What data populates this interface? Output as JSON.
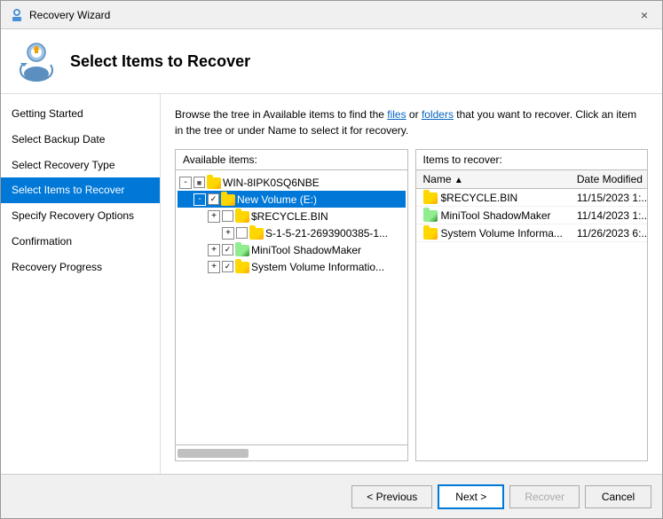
{
  "window": {
    "title": "Recovery Wizard",
    "close_label": "×"
  },
  "header": {
    "title": "Select Items to Recover"
  },
  "instruction": {
    "text1": "Browse the tree in Available items to find the files or folders that you want to recover. Click an item",
    "text2": "in the tree or under Name to select it for recovery."
  },
  "sidebar": {
    "items": [
      {
        "label": "Getting Started",
        "active": false
      },
      {
        "label": "Select Backup Date",
        "active": false
      },
      {
        "label": "Select Recovery Type",
        "active": false
      },
      {
        "label": "Select Items to Recover",
        "active": true
      },
      {
        "label": "Specify Recovery Options",
        "active": false
      },
      {
        "label": "Confirmation",
        "active": false
      },
      {
        "label": "Recovery Progress",
        "active": false
      }
    ]
  },
  "available_panel": {
    "header": "Available items:",
    "tree": [
      {
        "id": "root",
        "label": "WIN-8IPK0SQ6NBE",
        "level": 0,
        "toggle": "-",
        "folder": "yellow",
        "checked": "partial"
      },
      {
        "id": "vol_e",
        "label": "New Volume (E:)",
        "level": 1,
        "toggle": "-",
        "folder": "yellow",
        "checked": "checked",
        "selected": true
      },
      {
        "id": "recycle",
        "label": "$RECYCLE.BIN",
        "level": 2,
        "toggle": "+",
        "folder": "yellow",
        "checked": "unchecked"
      },
      {
        "id": "s1521",
        "label": "S-1-5-21-2693900385-1...",
        "level": 3,
        "toggle": "+",
        "folder": "yellow",
        "checked": "unchecked"
      },
      {
        "id": "minitool",
        "label": "MiniTool ShadowMaker",
        "level": 2,
        "toggle": "+",
        "folder": "green",
        "checked": "checked"
      },
      {
        "id": "sysvolinfo",
        "label": "System Volume Informatio...",
        "level": 2,
        "toggle": "+",
        "folder": "yellow",
        "checked": "checked"
      }
    ]
  },
  "recover_panel": {
    "header": "Items to recover:",
    "columns": [
      {
        "label": "Name",
        "sort": "▲"
      },
      {
        "label": "Date Modified"
      }
    ],
    "rows": [
      {
        "name": "$RECYCLE.BIN",
        "folder": "yellow",
        "date": "11/15/2023 1:..."
      },
      {
        "name": "MiniTool ShadowMaker",
        "folder": "green",
        "date": "11/14/2023 1:..."
      },
      {
        "name": "System Volume Informa...",
        "folder": "yellow",
        "date": "11/26/2023 6:..."
      }
    ]
  },
  "footer": {
    "previous_label": "< Previous",
    "next_label": "Next >",
    "recover_label": "Recover",
    "cancel_label": "Cancel"
  }
}
